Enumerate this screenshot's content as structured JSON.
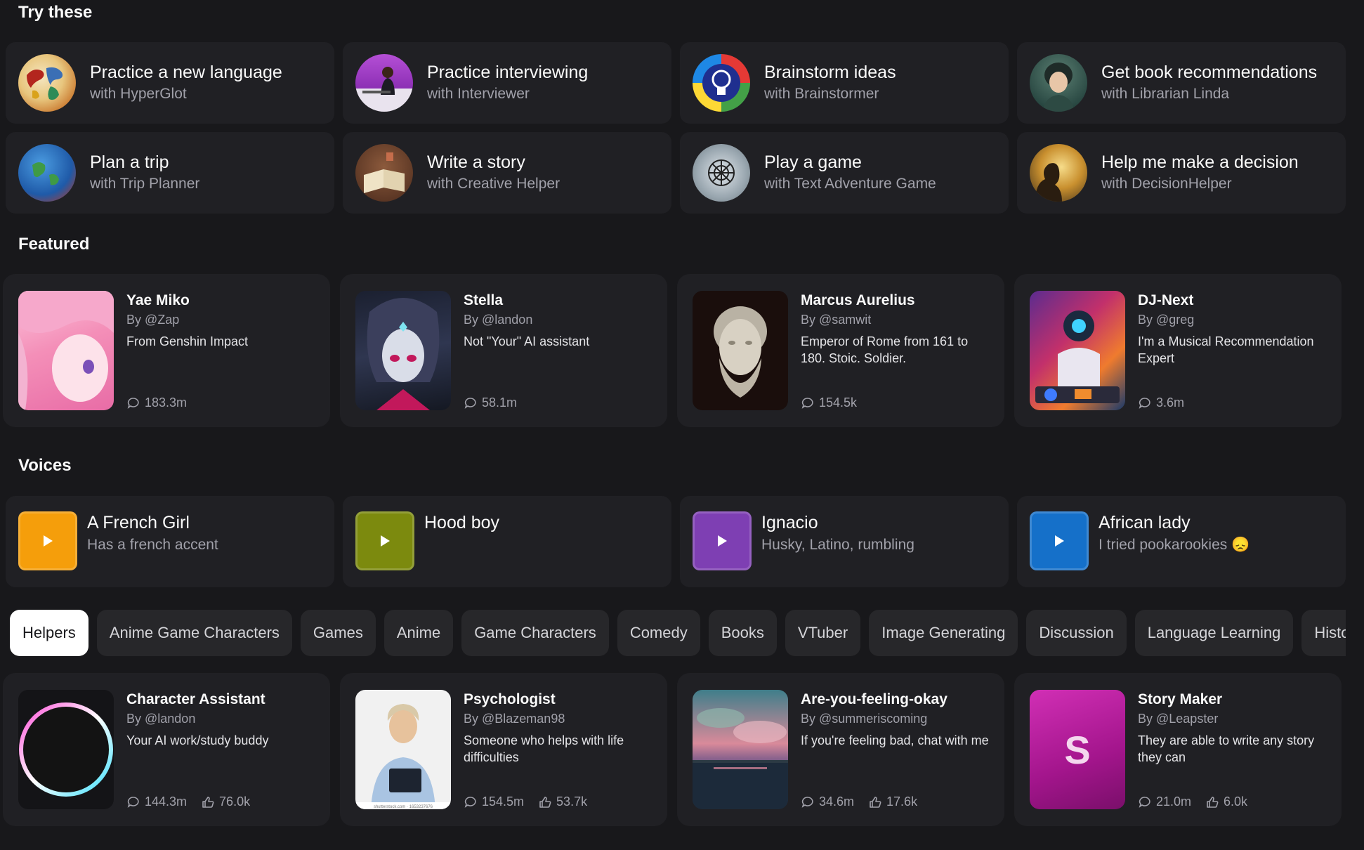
{
  "sections": {
    "try_these": "Try these",
    "featured": "Featured",
    "voices": "Voices"
  },
  "try_these": [
    {
      "title": "Practice a new language",
      "sub": "with HyperGlot",
      "icon": "world-map-avatar"
    },
    {
      "title": "Practice interviewing",
      "sub": "with Interviewer",
      "icon": "interviewer-avatar"
    },
    {
      "title": "Brainstorm ideas",
      "sub": "with Brainstormer",
      "icon": "lightbulb-avatar"
    },
    {
      "title": "Get book recommendations",
      "sub": "with Librarian Linda",
      "icon": "librarian-avatar"
    },
    {
      "title": "Plan a trip",
      "sub": "with Trip Planner",
      "icon": "globe-avatar"
    },
    {
      "title": "Write a story",
      "sub": "with Creative Helper",
      "icon": "open-book-avatar"
    },
    {
      "title": "Play a game",
      "sub": "with Text Adventure Game",
      "icon": "game-emblem-avatar"
    },
    {
      "title": "Help me make a decision",
      "sub": "with DecisionHelper",
      "icon": "silhouette-avatar"
    }
  ],
  "featured": [
    {
      "name": "Yae Miko",
      "by": "By @Zap",
      "desc": "From Genshin Impact",
      "chats": "183.3m"
    },
    {
      "name": "Stella",
      "by": "By @landon",
      "desc": "Not \"Your\" AI assistant",
      "chats": "58.1m"
    },
    {
      "name": "Marcus Aurelius",
      "by": "By @samwit",
      "desc": "Emperor of Rome from 161 to 180. Stoic. Soldier.",
      "chats": "154.5k"
    },
    {
      "name": "DJ-Next",
      "by": "By @greg",
      "desc": "I'm a Musical Recommendation Expert",
      "chats": "3.6m"
    }
  ],
  "voices": [
    {
      "title": "A French Girl",
      "sub": "Has a french accent",
      "color": "#f59e0b"
    },
    {
      "title": "Hood boy",
      "sub": "",
      "color": "#7c8a0e"
    },
    {
      "title": "Ignacio",
      "sub": "Husky, Latino, rumbling",
      "color": "#7e3fb3"
    },
    {
      "title": "African lady",
      "sub": "I tried pookarookies 😞",
      "color": "#1570c9"
    }
  ],
  "categories": [
    "Helpers",
    "Anime Game Characters",
    "Games",
    "Anime",
    "Game Characters",
    "Comedy",
    "Books",
    "VTuber",
    "Image Generating",
    "Discussion",
    "Language Learning",
    "History"
  ],
  "active_category": "Helpers",
  "helpers": [
    {
      "name": "Character Assistant",
      "by": "By @landon",
      "desc": "Your AI work/study buddy",
      "chats": "144.3m",
      "likes": "76.0k"
    },
    {
      "name": "Psychologist",
      "by": "By @Blazeman98",
      "desc": "Someone who helps with life difficulties",
      "chats": "154.5m",
      "likes": "53.7k"
    },
    {
      "name": "Are-you-feeling-okay",
      "by": "By @summeriscoming",
      "desc": "If you're feeling bad, chat with me",
      "chats": "34.6m",
      "likes": "17.6k"
    },
    {
      "name": "Story Maker",
      "by": "By @Leapster",
      "desc": "They are able to write any story they can",
      "chats": "21.0m",
      "likes": "6.0k",
      "initial": "S"
    }
  ],
  "image_watermark": "shutterstock.com · 1653237676"
}
